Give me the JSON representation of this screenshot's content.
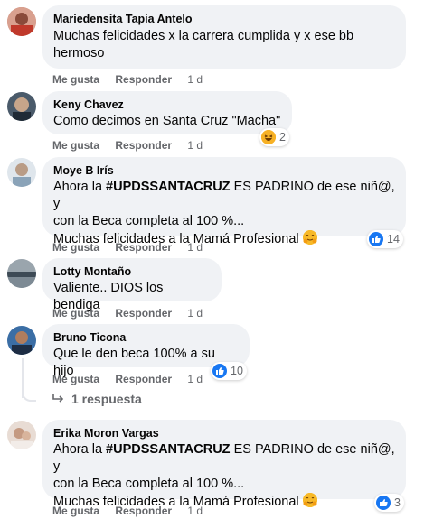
{
  "comments": [
    {
      "author": "Mariedensita Tapia Antelo",
      "text": "Muchas felicidades x la carrera cumplida y x ese bb\nhermoso",
      "like": "Me gusta",
      "reply": "Responder",
      "time": "1 d"
    },
    {
      "author": "Keny Chavez",
      "text": "Como decimos en Santa Cruz \"Macha\"",
      "like": "Me gusta",
      "reply": "Responder",
      "time": "1 d",
      "reactions": {
        "icon": "haha-icon",
        "count": "2"
      }
    },
    {
      "author": "Moye B Irís",
      "text_pre": "Ahora la ",
      "hashtag": "#UPDSSANTACRUZ",
      "text_post": " ES PADRINO de ese niñ@, y\ncon la Beca completa al 100 %...\nMuchas felicidades a la Mamá Profesional",
      "like": "Me gusta",
      "reply": "Responder",
      "time": "1 d",
      "reactions": {
        "icon": "like-icon",
        "count": "14"
      }
    },
    {
      "author": "Lotty Montaño",
      "text": "Valiente.. DIOS los bendiga",
      "like": "Me gusta",
      "reply": "Responder",
      "time": "1 d"
    },
    {
      "author": "Bruno Ticona",
      "text": "Que le den beca 100% a su hijo",
      "like": "Me gusta",
      "reply": "Responder",
      "time": "1 d",
      "reactions": {
        "icon": "like-icon",
        "count": "10"
      }
    },
    {
      "author": "Erika Moron Vargas",
      "text_pre": "Ahora la ",
      "hashtag": "#UPDSSANTACRUZ",
      "text_post": " ES PADRINO de ese niñ@, y\ncon la Beca completa al 100 %...\nMuchas felicidades a la Mamá Profesional",
      "like": "Me gusta",
      "reply": "Responder",
      "time": "1 d",
      "reactions": {
        "icon": "like-icon",
        "count": "3"
      }
    }
  ],
  "replies_link": "1 respuesta",
  "colors": {
    "bubble": "#f0f2f5",
    "like_blue": "#1877f2",
    "meta_gray": "#65676b"
  }
}
